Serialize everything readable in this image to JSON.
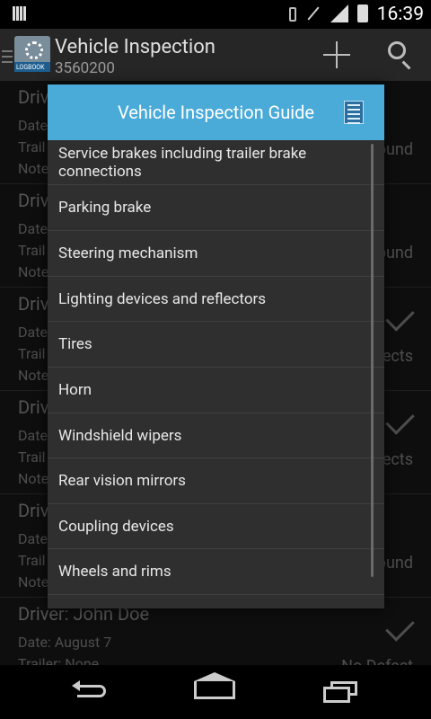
{
  "status_bar": {
    "time": "16:39"
  },
  "action_bar": {
    "logo_text": "LOGBOOK",
    "title": "Vehicle Inspection",
    "subtitle": "3560200"
  },
  "background_entries": [
    {
      "driver": "Driv",
      "line1": "Date",
      "line2": "Trail",
      "line3": "Note",
      "status": "ound"
    },
    {
      "driver": "Driv",
      "line1": "Date",
      "line2": "Trail",
      "line3": "Note",
      "status": "ound"
    },
    {
      "driver": "Driv",
      "line1": "Date",
      "line2": "Trail",
      "line3": "Note",
      "status": "ects"
    },
    {
      "driver": "Driv",
      "line1": "Date",
      "line2": "Trail",
      "line3": "Note",
      "status": "ects"
    },
    {
      "driver": "Driv",
      "line1": "Date",
      "line2": "Trail",
      "line3": "Note",
      "status": "ound"
    },
    {
      "driver": "Driver: John Doe",
      "line1": "Date: August 7",
      "line2": "Trailer: None",
      "line3": "",
      "status": "No Defect"
    }
  ],
  "dialog": {
    "title": "Vehicle Inspection Guide",
    "items": [
      "Service brakes including trailer brake connections",
      "Parking brake",
      "Steering mechanism",
      "Lighting devices and reflectors",
      "Tires",
      "Horn",
      "Windshield wipers",
      "Rear vision mirrors",
      "Coupling devices",
      "Wheels and rims",
      ""
    ]
  }
}
